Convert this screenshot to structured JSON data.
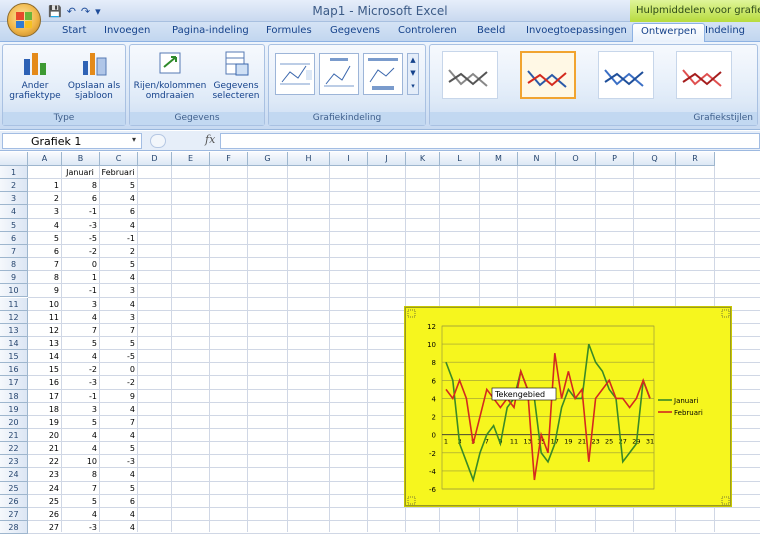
{
  "window": {
    "title": "Map1 - Microsoft Excel",
    "context_tab": "Hulpmiddelen voor grafieken"
  },
  "tabs": [
    {
      "label": "Start"
    },
    {
      "label": "Invoegen"
    },
    {
      "label": "Pagina-indeling"
    },
    {
      "label": "Formules"
    },
    {
      "label": "Gegevens"
    },
    {
      "label": "Controleren"
    },
    {
      "label": "Beeld"
    },
    {
      "label": "Invoegtoepassingen"
    },
    {
      "label": "Ontwerpen"
    },
    {
      "label": "Indeling"
    }
  ],
  "ribbon": {
    "type_group": {
      "label": "Type",
      "btn1_line1": "Ander",
      "btn1_line2": "grafiektype",
      "btn2_line1": "Opslaan als",
      "btn2_line2": "sjabloon"
    },
    "data_group": {
      "label": "Gegevens",
      "btn1_line1": "Rijen/kolommen",
      "btn1_line2": "omdraaien",
      "btn2_line1": "Gegevens",
      "btn2_line2": "selecteren"
    },
    "layout_group": {
      "label": "Grafiekindeling"
    },
    "styles_group": {
      "label": "Grafiekstijlen"
    }
  },
  "name_box": "Grafiek 1",
  "fx": "fx",
  "columns": [
    "A",
    "B",
    "C",
    "D",
    "E",
    "F",
    "G",
    "H",
    "I",
    "J",
    "K",
    "L",
    "M",
    "N",
    "O",
    "P",
    "Q",
    "R"
  ],
  "rows": [
    "1",
    "2",
    "3",
    "4",
    "5",
    "6",
    "7",
    "8",
    "9",
    "10",
    "11",
    "12",
    "13",
    "14",
    "15",
    "16",
    "17",
    "18",
    "19",
    "20",
    "21",
    "22",
    "23",
    "24",
    "25",
    "26",
    "27",
    "28"
  ],
  "headers": {
    "b": "Januari",
    "c": "Februari"
  },
  "table": [
    [
      "1",
      "8",
      "5"
    ],
    [
      "2",
      "6",
      "4"
    ],
    [
      "3",
      "-1",
      "6"
    ],
    [
      "4",
      "-3",
      "4"
    ],
    [
      "5",
      "-5",
      "-1"
    ],
    [
      "6",
      "-2",
      "2"
    ],
    [
      "7",
      "0",
      "5"
    ],
    [
      "8",
      "1",
      "4"
    ],
    [
      "9",
      "-1",
      "3"
    ],
    [
      "10",
      "3",
      "4"
    ],
    [
      "11",
      "4",
      "3"
    ],
    [
      "12",
      "7",
      "7"
    ],
    [
      "13",
      "5",
      "5"
    ],
    [
      "14",
      "4",
      "-5"
    ],
    [
      "15",
      "-2",
      "0"
    ],
    [
      "16",
      "-3",
      "-2"
    ],
    [
      "17",
      "-1",
      "9"
    ],
    [
      "18",
      "3",
      "4"
    ],
    [
      "19",
      "5",
      "7"
    ],
    [
      "20",
      "4",
      "4"
    ],
    [
      "21",
      "4",
      "5"
    ],
    [
      "22",
      "10",
      "-3"
    ],
    [
      "23",
      "8",
      "4"
    ],
    [
      "24",
      "7",
      "5"
    ],
    [
      "25",
      "5",
      "6"
    ],
    [
      "26",
      "4",
      "4"
    ],
    [
      "27",
      "-3",
      "4"
    ]
  ],
  "chart_data": {
    "type": "line",
    "x": [
      1,
      2,
      3,
      4,
      5,
      6,
      7,
      8,
      9,
      10,
      11,
      12,
      13,
      14,
      15,
      16,
      17,
      18,
      19,
      20,
      21,
      22,
      23,
      24,
      25,
      26,
      27,
      28,
      29,
      30,
      31
    ],
    "x_tick_labels": [
      "1",
      "3",
      "5",
      "7",
      "9",
      "11",
      "13",
      "15",
      "17",
      "19",
      "21",
      "23",
      "25",
      "27",
      "29",
      "31"
    ],
    "ylim": [
      -6,
      12
    ],
    "y_ticks": [
      -6,
      -4,
      -2,
      0,
      2,
      4,
      6,
      8,
      10,
      12
    ],
    "grid": true,
    "legend": "right",
    "tooltip": "Tekengebied",
    "series": [
      {
        "name": "Januari",
        "color": "#3a8a26",
        "values": [
          8,
          6,
          -1,
          -3,
          -5,
          -2,
          0,
          1,
          -1,
          3,
          4,
          7,
          5,
          4,
          -2,
          -3,
          -1,
          3,
          5,
          4,
          4,
          10,
          8,
          7,
          5,
          4,
          -3,
          -2,
          -1,
          6,
          4
        ]
      },
      {
        "name": "Februari",
        "color": "#d42a1e",
        "values": [
          5,
          4,
          6,
          4,
          -1,
          2,
          5,
          4,
          3,
          4,
          3,
          7,
          5,
          -5,
          0,
          -2,
          9,
          4,
          7,
          4,
          5,
          -3,
          4,
          5,
          6,
          4,
          4,
          3,
          4,
          6,
          4
        ]
      }
    ]
  }
}
